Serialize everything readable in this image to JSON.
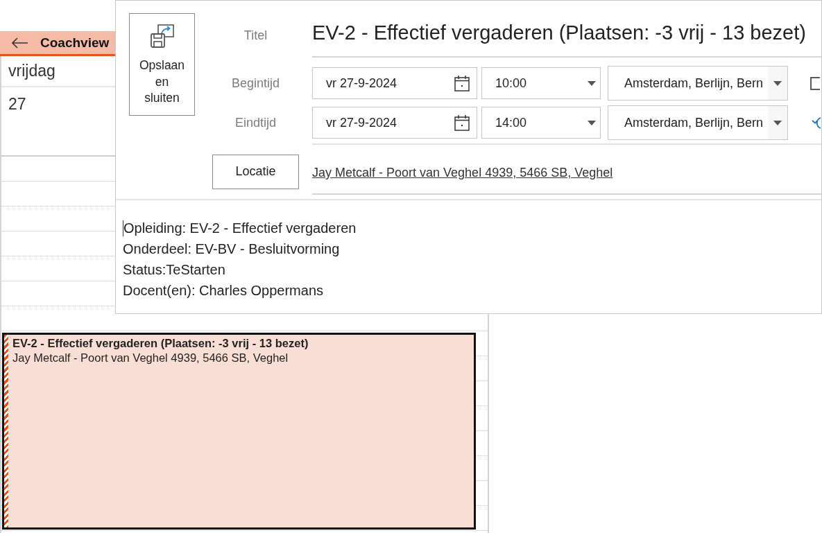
{
  "calendar": {
    "header": {
      "title": "Coachview"
    },
    "day": {
      "name": "vrijdag",
      "number": "27"
    },
    "appointment": {
      "tentative": true,
      "title": "EV-2 - Effectief vergaderen (Plaatsen: -3 vrij - 13 bezet)",
      "location": "Jay Metcalf - Poort van Veghel 4939, 5466 SB, Veghel"
    }
  },
  "appointment_window": {
    "save_button": {
      "label": "Opslaan en sluiten"
    },
    "title": {
      "label": "Titel",
      "value": "EV-2 - Effectief vergaderen (Plaatsen: -3 vrij - 13 bezet)"
    },
    "start": {
      "label": "Begintijd",
      "date": "vr 27-9-2024",
      "time": "10:00",
      "time_zone": "Amsterdam, Berlijn, Bern"
    },
    "end": {
      "label": "Eindtijd",
      "date": "vr 27-9-2024",
      "time": "14:00",
      "time_zone": "Amsterdam, Berlijn, Bern"
    },
    "checkbox": {
      "checked": false
    },
    "location": {
      "button": "Locatie",
      "value": "Jay Metcalf - Poort van Veghel 4939, 5466 SB, Veghel"
    },
    "body": [
      "Opleiding: EV-2 - Effectief vergaderen",
      "Onderdeel: EV-BV - Besluitvorming",
      "Status:TeStarten",
      "Docent(en): Charles Oppermans"
    ]
  }
}
